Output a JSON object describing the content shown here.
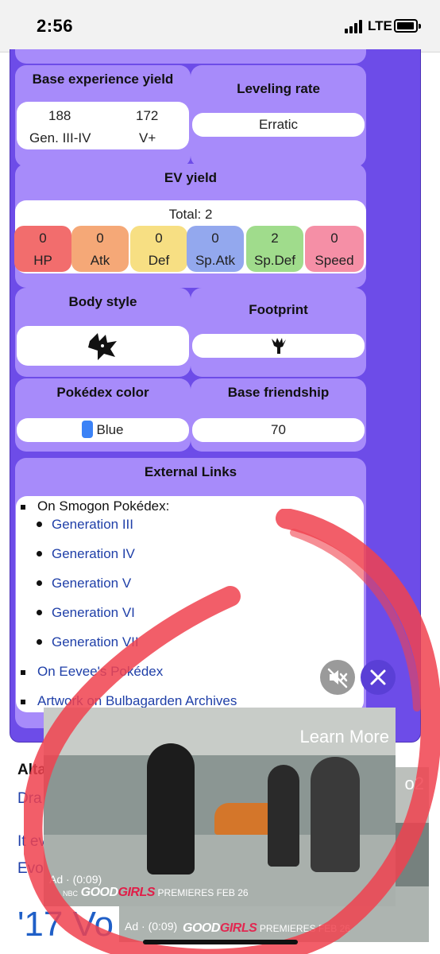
{
  "status_bar": {
    "time": "2:56",
    "network": "LTE"
  },
  "infobox": {
    "base_exp": {
      "title": "Base experience yield",
      "values": [
        {
          "value": "188",
          "label": "Gen. III-IV"
        },
        {
          "value": "172",
          "label": "V+"
        }
      ]
    },
    "leveling": {
      "title": "Leveling rate",
      "value": "Erratic"
    },
    "ev_yield": {
      "title": "EV yield",
      "total": "Total: 2",
      "stats": [
        {
          "value": "0",
          "label": "HP",
          "color": "#f26d6d"
        },
        {
          "value": "0",
          "label": "Atk",
          "color": "#f5a877"
        },
        {
          "value": "0",
          "label": "Def",
          "color": "#f7df83"
        },
        {
          "value": "0",
          "label": "Sp.Atk",
          "color": "#93a8ee"
        },
        {
          "value": "2",
          "label": "Sp.Def",
          "color": "#a0dc8c"
        },
        {
          "value": "0",
          "label": "Speed",
          "color": "#f58fa6"
        }
      ]
    },
    "body_style": {
      "title": "Body style"
    },
    "footprint": {
      "title": "Footprint"
    },
    "pokedex_color": {
      "title": "Pokédex color",
      "value": "Blue",
      "swatch": "#3b82f6"
    },
    "base_friendship": {
      "title": "Base friendship",
      "value": "70"
    },
    "external_links": {
      "title": "External Links",
      "smogon_label": "On Smogon Pokédex:",
      "generations": [
        "Generation III",
        "Generation IV",
        "Generation V",
        "Generation VI",
        "Generation VII"
      ],
      "eevee": "On Eevee's Pokédex",
      "bulbagarden": "Artwork on Bulbagarden Archives"
    }
  },
  "page_text": {
    "line1": "Alta",
    "line2": "Dra",
    "line3": "It ev",
    "line4": "Evo",
    "big": "'17 Vo",
    "partial": "o2"
  },
  "video_ad": {
    "learn_more": "Learn More",
    "ad_label": "Ad · (0:09)",
    "network": "NBC",
    "show_good": "GOOD",
    "show_girls": "GIRLS",
    "premieres": "PREMIERES FEB 26"
  },
  "colors": {
    "infobox_bg": "#6d4ce8",
    "cell_bg": "#a78bfa",
    "annotation": "#f0424f"
  }
}
